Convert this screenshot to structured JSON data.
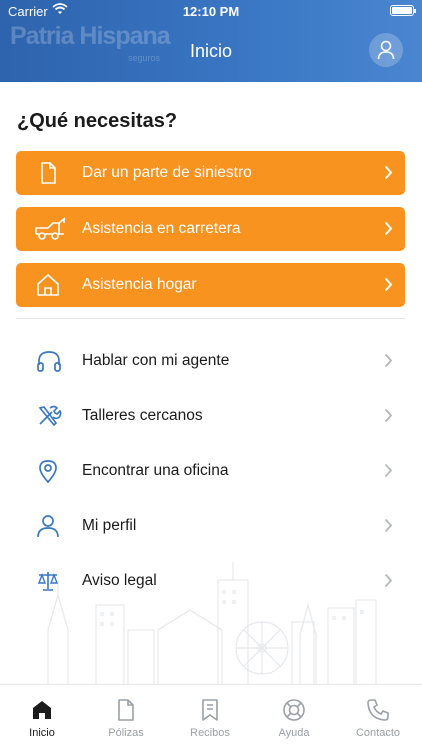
{
  "status_bar": {
    "carrier": "Carrier",
    "time": "12:10 PM"
  },
  "header": {
    "logo_text": "Patria Hispana",
    "logo_sub": "seguros",
    "title": "Inicio",
    "accent": "#3a77c4"
  },
  "main": {
    "question": "¿Qué necesitas?",
    "primary_actions": [
      {
        "label": "Dar un parte de siniestro",
        "icon": "document-icon"
      },
      {
        "label": "Asistencia en carretera",
        "icon": "tow-truck-icon"
      },
      {
        "label": "Asistencia hogar",
        "icon": "home-icon"
      }
    ],
    "menu": [
      {
        "label": "Hablar con mi agente",
        "icon": "headphones-icon"
      },
      {
        "label": "Talleres cercanos",
        "icon": "tools-icon"
      },
      {
        "label": "Encontrar una oficina",
        "icon": "location-pin-icon"
      },
      {
        "label": "Mi perfil",
        "icon": "user-icon"
      },
      {
        "label": "Aviso legal",
        "icon": "scales-icon"
      }
    ],
    "action_color": "#f7931e"
  },
  "tabs": [
    {
      "label": "Inicio",
      "icon": "home-icon",
      "active": true
    },
    {
      "label": "Pólizas",
      "icon": "document-icon",
      "active": false
    },
    {
      "label": "Recibos",
      "icon": "bookmark-icon",
      "active": false
    },
    {
      "label": "Ayuda",
      "icon": "lifebuoy-icon",
      "active": false
    },
    {
      "label": "Contacto",
      "icon": "phone-icon",
      "active": false
    }
  ]
}
